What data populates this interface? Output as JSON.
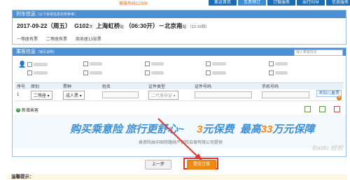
{
  "header": {
    "service_hotline": "客服热线12306",
    "nav": [
      "客运首页",
      "车票预订",
      "订餐服务",
      "出行向导",
      "信息服务"
    ]
  },
  "train_panel": {
    "title": "列车信息",
    "note": "（以下余票信息仅供参考）",
    "date": "2017-09-22（周五）",
    "train_no": "G102",
    "train_suffix": "次",
    "from": "上海虹桥",
    "from_suffix": "站",
    "depart": "（06:30开）",
    "arrow": "－",
    "to": "北京南",
    "to_suffix": "站",
    "arrive": "（12:10到）",
    "seats": [
      "一等座有票",
      "二等座有票",
      "商务座13张票"
    ]
  },
  "passenger_panel": {
    "title": "乘客信息",
    "note": "（填写说明）",
    "search_placeholder": "输入乘客姓名",
    "columns": [
      "序号",
      "席别",
      "票种",
      "姓名",
      "证件类型",
      "证件号码",
      "手机号码"
    ],
    "row": {
      "index": "1",
      "seat": "二等座",
      "ticket_type": "成人票",
      "id_type": "二代身份证",
      "add_child": "添加儿童票"
    },
    "add_passenger": "新增乘客"
  },
  "banner": {
    "left": "购买乘意险  旅行更舒心~",
    "fee_prefix": "3",
    "fee_unit": "元保费",
    "max_prefix": "最高",
    "max_value": "33",
    "max_suffix": "万元保障",
    "sub": "乘意险由中国铁路财产保险自保有限公司提供"
  },
  "actions": {
    "back": "上一步",
    "submit": "提交订单"
  },
  "tips": "温馨提示：",
  "watermark": "Baidu 经验",
  "colors": {
    "header_blue": "#4d8fd3",
    "submit_orange": "#f28a10",
    "highlight_red": "#e0362a"
  }
}
